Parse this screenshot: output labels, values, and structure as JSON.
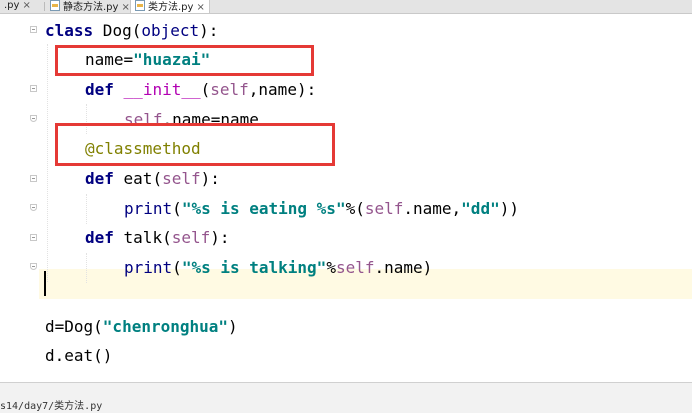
{
  "tabs": [
    {
      "label": ".py",
      "active": false
    },
    {
      "label": "静态方法.py",
      "active": false
    },
    {
      "label": "类方法.py",
      "active": true
    }
  ],
  "tab_close_glyph": "×",
  "code": {
    "l1": {
      "kw": "class",
      "name": " Dog(",
      "base": "object",
      "end": "):"
    },
    "l2": {
      "var": "name=",
      "str": "\"huazai\""
    },
    "l3": {
      "kw": "def",
      "sp": " ",
      "fn": "__init__",
      "open": "(",
      "self": "self",
      "rest": ",name):"
    },
    "l4": {
      "self": "self",
      "rest": ".name=name"
    },
    "l5": {
      "deco": "@classmethod"
    },
    "l6": {
      "kw": "def",
      "fn": " eat(",
      "self": "self",
      "end": "):"
    },
    "l7": {
      "print": "print",
      "open": "(",
      "str": "\"%s is eating %s\"",
      "mid": "%(",
      "self": "self",
      "mid2": ".name,",
      "str2": "\"dd\"",
      "end": "))"
    },
    "l8": {
      "kw": "def",
      "fn": " talk(",
      "self": "self",
      "end": "):"
    },
    "l9": {
      "print": "print",
      "open": "(",
      "str": "\"%s is talking\"",
      "mid": "%",
      "self": "self",
      "end": ".name)"
    },
    "l11": {
      "pre": "d=Dog(",
      "str": "\"chenronghua\"",
      "end": ")"
    },
    "l12": {
      "text": "d.eat()"
    }
  },
  "status": {
    "path": "s14/day7/类方法.py"
  },
  "colors": {
    "annotation_box": "#e53935",
    "current_line": "#fffae3"
  }
}
